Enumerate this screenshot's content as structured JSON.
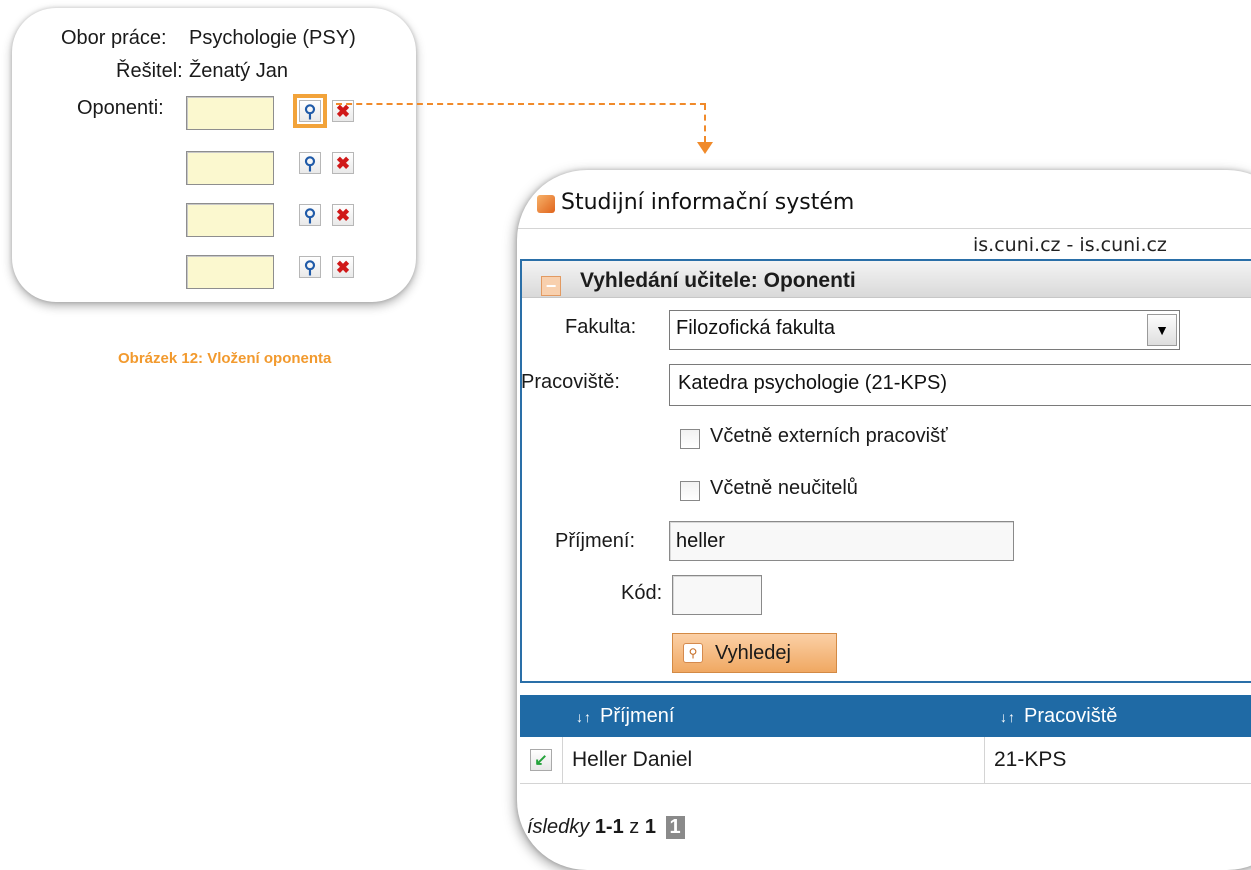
{
  "left_form": {
    "field_label": "Obor práce:",
    "field_value": "Psychologie (PSY)",
    "solver_label": "Řešitel:",
    "solver_value": "Ženatý Jan",
    "opponents_label": "Oponenti:",
    "opponent_rows": 4
  },
  "caption": "Obrázek 12: Vložení oponenta",
  "popup": {
    "window_title": "Studijní informační systém",
    "host": "is.cuni.cz - is.cuni.cz",
    "panel_title": "Vyhledání učitele: Oponenti",
    "collapse_symbol": "−",
    "faculty_label": "Fakulta:",
    "faculty_value": "Filozofická fakulta",
    "workplace_label": "Pracoviště:",
    "workplace_value": "Katedra psychologie (21-KPS)",
    "include_external_label": "Včetně externích pracovišť",
    "include_external_checked": false,
    "include_nonteachers_label": "Včetně neučitelů",
    "include_nonteachers_checked": false,
    "surname_label": "Příjmení:",
    "surname_value": "heller",
    "code_label": "Kód:",
    "code_value": "",
    "search_button": "Vyhledej",
    "table": {
      "headers": [
        "Příjmení",
        "Pracoviště"
      ],
      "rows": [
        {
          "name": "Heller Daniel",
          "workplace": "21-KPS"
        }
      ]
    },
    "results": {
      "prefix": "ísledky",
      "range": "1-1",
      "of": "z",
      "total": "1",
      "current_page": "1"
    }
  },
  "colors": {
    "accent_orange": "#f2a33a",
    "grid_header_blue": "#1f6aa5",
    "input_yellow": "#fbf8cf",
    "caption_orange": "#f29a2e"
  },
  "icons": {
    "search": "search-icon",
    "delete": "delete-icon",
    "select": "select-arrow-icon"
  }
}
